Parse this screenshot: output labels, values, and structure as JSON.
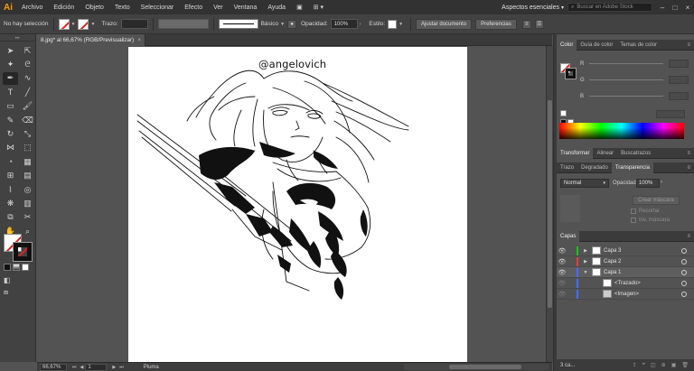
{
  "app": {
    "logo": "Ai",
    "menu": [
      "Archivo",
      "Edición",
      "Objeto",
      "Texto",
      "Seleccionar",
      "Efecto",
      "Ver",
      "Ventana",
      "Ayuda"
    ],
    "workspace": "Aspectos esenciales",
    "search_placeholder": "Buscar en Adobe Stock",
    "accent_color": "#ff9a00"
  },
  "control_bar": {
    "selection": "No hay selección",
    "stroke_label": "Trazo:",
    "brush_label": "Básico",
    "opacity_label": "Opacidad:",
    "opacity_value": "100%",
    "style_label": "Estilo:",
    "fit_button": "Ajustar documento",
    "prefs_button": "Preferencias"
  },
  "document": {
    "tab_title": "8.jpg* al 66,67% (RGB/Previsualizar)",
    "watermark": "@angelovich"
  },
  "status_bar": {
    "zoom": "66,67%",
    "artboard": "1",
    "tool": "Pluma"
  },
  "panels": {
    "color": {
      "tabs": [
        "Color",
        "Guía de color",
        "Temas de color"
      ],
      "channels": [
        "R",
        "G",
        "B"
      ]
    },
    "transform": {
      "tabs": [
        "Transformar",
        "Alinear",
        "Buscatrazos"
      ]
    },
    "transparency": {
      "tabs": [
        "Trazo",
        "Degradado",
        "Transparencia"
      ],
      "blend_mode": "Normal",
      "opacity_label": "Opacidad:",
      "opacity_value": "100%",
      "mask_button": "Crear máscara",
      "clip": "Recortar",
      "invert": "Inv. máscara"
    },
    "layers": {
      "title": "Capas",
      "items": [
        {
          "name": "Capa 3",
          "color": "#20c020"
        },
        {
          "name": "Capa 2",
          "color": "#e04040"
        },
        {
          "name": "Capa 1",
          "color": "#4a6cff"
        }
      ],
      "subitems": [
        "<Trazado>",
        "<Imagen>"
      ],
      "footer": "3 ca..."
    }
  }
}
